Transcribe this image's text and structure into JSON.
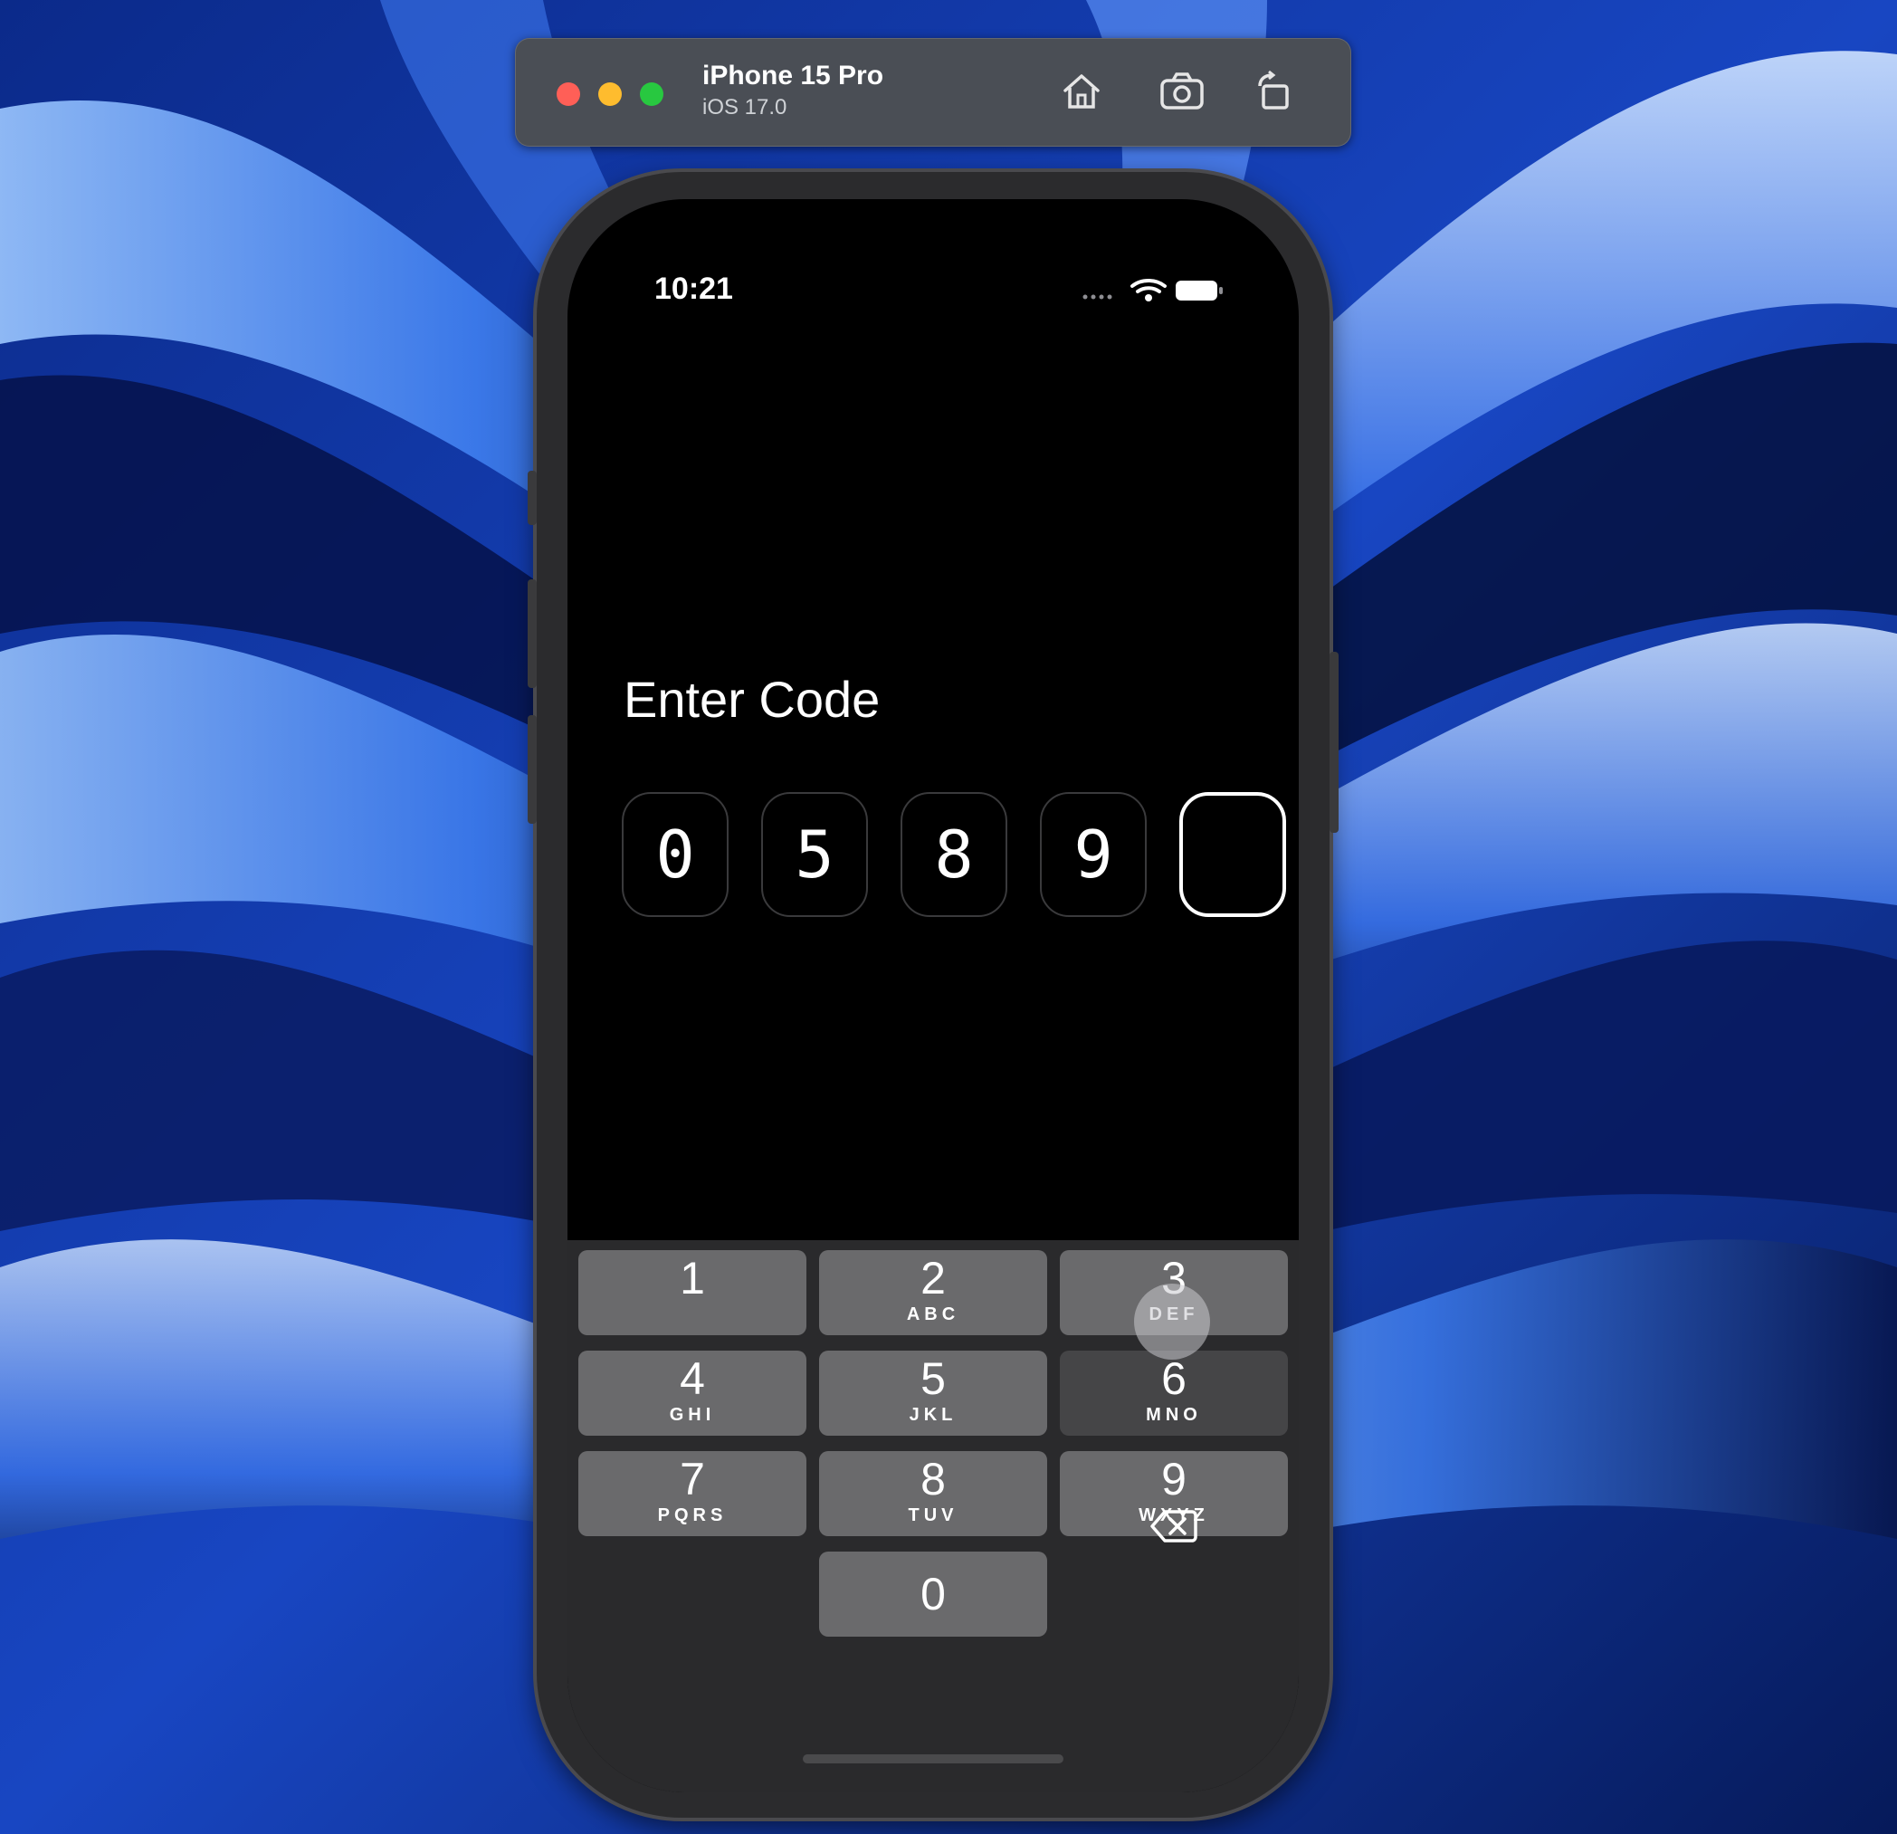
{
  "window": {
    "device_name": "iPhone 15 Pro",
    "os_version": "iOS 17.0",
    "controls": [
      "close",
      "minimize",
      "zoom"
    ],
    "toolbar_icons": [
      "home-icon",
      "screenshot-icon",
      "rotate-icon"
    ]
  },
  "status_bar": {
    "time": "10:21",
    "icons": [
      "signal-icon",
      "wifi-icon",
      "battery-icon"
    ]
  },
  "screen": {
    "title": "Enter Code",
    "code_digits": [
      "0",
      "5",
      "8",
      "9",
      ""
    ],
    "active_index": 4
  },
  "keypad": {
    "keys": [
      {
        "num": "1",
        "letters": ""
      },
      {
        "num": "2",
        "letters": "ABC"
      },
      {
        "num": "3",
        "letters": "DEF"
      },
      {
        "num": "4",
        "letters": "GHI"
      },
      {
        "num": "5",
        "letters": "JKL"
      },
      {
        "num": "6",
        "letters": "MNO"
      },
      {
        "num": "7",
        "letters": "PQRS"
      },
      {
        "num": "8",
        "letters": "TUV"
      },
      {
        "num": "9",
        "letters": "WXYZ"
      },
      {
        "num": "0",
        "letters": ""
      }
    ],
    "pressed_key": "6",
    "delete_icon": "delete-backspace-icon"
  },
  "colors": {
    "background": "#000000",
    "key": "#6a6a6c",
    "keypad": "#2a2a2c",
    "text": "#ffffff"
  }
}
